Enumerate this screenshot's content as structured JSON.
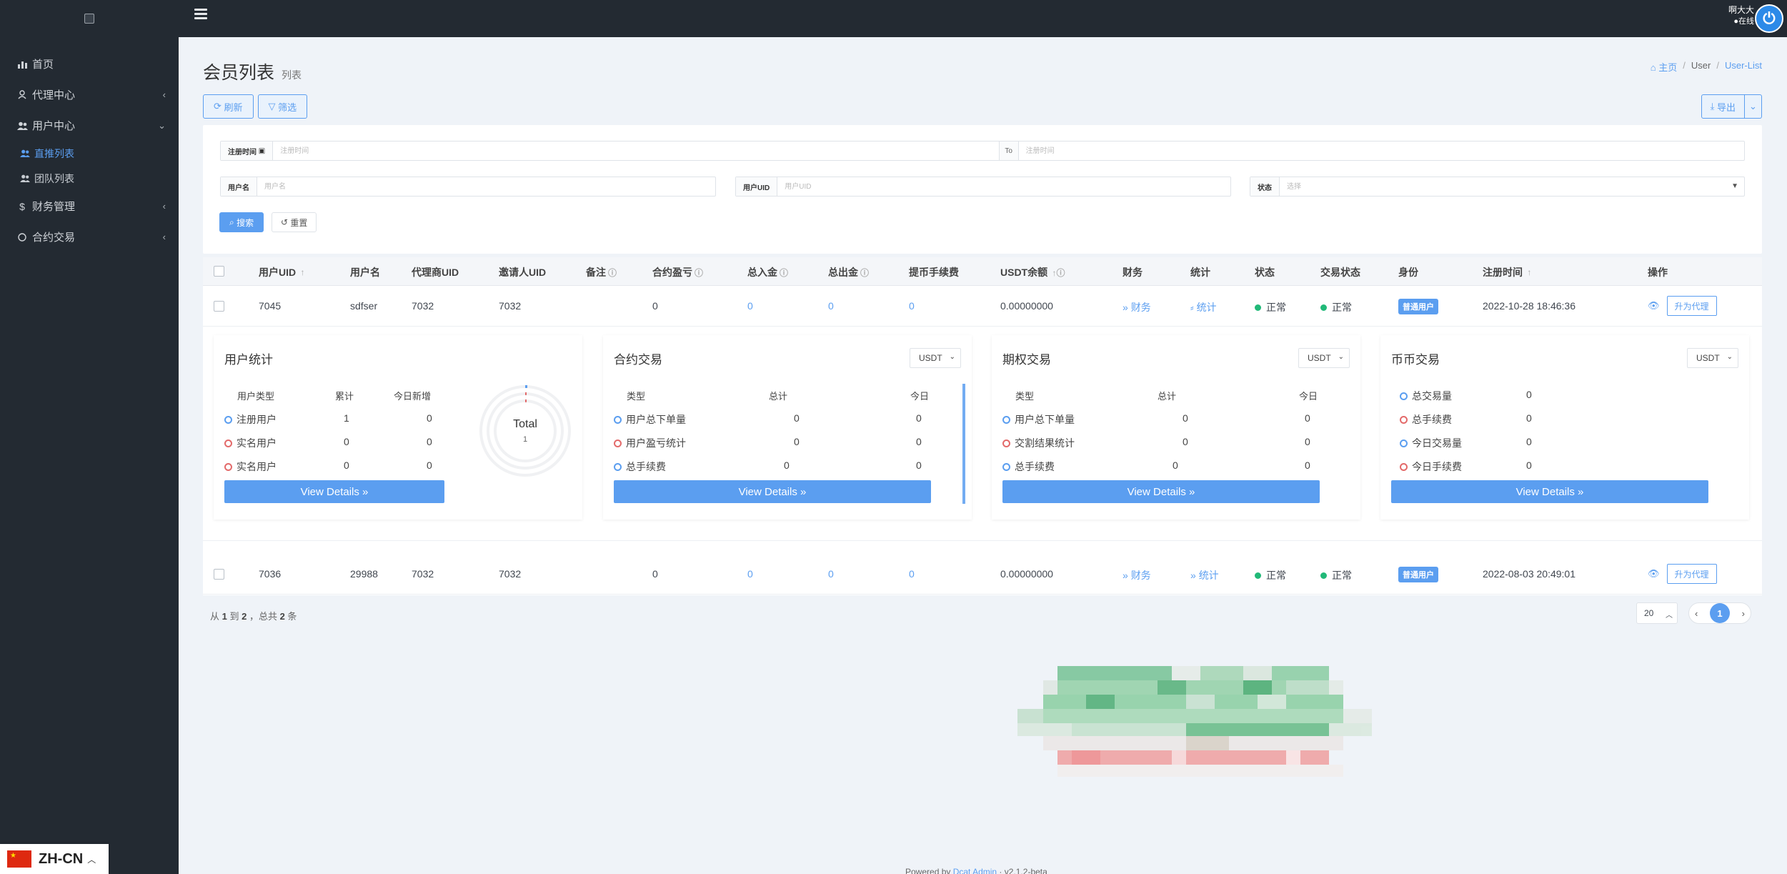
{
  "sidebar": {
    "items": [
      {
        "label": "首页",
        "icon": "bar-chart-icon"
      },
      {
        "label": "代理中心",
        "icon": "user-icon"
      },
      {
        "label": "用户中心",
        "icon": "users-icon"
      },
      {
        "label": "财务管理",
        "icon": "dollar-icon"
      },
      {
        "label": "合约交易",
        "icon": "circle-icon"
      }
    ],
    "sub_items": [
      {
        "label": "直推列表",
        "active": true
      },
      {
        "label": "团队列表",
        "active": false
      }
    ],
    "language": "ZH-CN"
  },
  "header": {
    "username": "啊大大",
    "status": "●在线"
  },
  "page": {
    "title": "会员列表",
    "subtitle": "列表",
    "breadcrumb": [
      "主页",
      "User",
      "User-List"
    ],
    "refresh_label": "刷新",
    "filter_label": "筛选",
    "export_label": "导出"
  },
  "filters": {
    "reg_time_label": "注册时间",
    "reg_time_placeholder": "注册时间",
    "to_label": "To",
    "reg_time_to_placeholder": "注册时间",
    "username_label": "用户名",
    "username_placeholder": "用户名",
    "uid_label": "用户UID",
    "uid_placeholder": "用户UID",
    "status_label": "状态",
    "status_placeholder": "选择",
    "search_label": "搜索",
    "reset_label": "重置"
  },
  "table": {
    "headers": {
      "uid": "用户UID",
      "username": "用户名",
      "agent_uid": "代理商UID",
      "inviter_uid": "邀请人UID",
      "remark": "备注",
      "contract_pnl": "合约盈亏",
      "total_in": "总入金",
      "total_out": "总出金",
      "withdraw_fee": "提币手续费",
      "usdt_balance": "USDT余额",
      "finance": "财务",
      "stats": "统计",
      "status": "状态",
      "trade_status": "交易状态",
      "identity": "身份",
      "reg_time": "注册时间",
      "action": "操作"
    },
    "rows": [
      {
        "uid": "7045",
        "username": "sdfser",
        "agent_uid": "7032",
        "inviter_uid": "7032",
        "remark": "",
        "contract_pnl": "0",
        "total_in": "0",
        "total_out": "0",
        "withdraw_fee": "0",
        "usdt_balance": "0.00000000",
        "finance": "财务",
        "stats": "统计",
        "status": "正常",
        "trade_status": "正常",
        "identity": "普通用户",
        "reg_time": "2022-10-28 18:46:36",
        "action": "升为代理"
      },
      {
        "uid": "7036",
        "username": "29988",
        "agent_uid": "7032",
        "inviter_uid": "7032",
        "remark": "",
        "contract_pnl": "0",
        "total_in": "0",
        "total_out": "0",
        "withdraw_fee": "0",
        "usdt_balance": "0.00000000",
        "finance": "财务",
        "stats": "统计",
        "status": "正常",
        "trade_status": "正常",
        "identity": "普通用户",
        "reg_time": "2022-08-03 20:49:01",
        "action": "升为代理"
      }
    ]
  },
  "detail": {
    "view_details": "View Details",
    "user_stats": {
      "title": "用户统计",
      "headers": [
        "用户类型",
        "累计",
        "今日新增"
      ],
      "rows": [
        {
          "name": "注册用户",
          "total": "1",
          "today": "0"
        },
        {
          "name": "实名用户",
          "total": "0",
          "today": "0"
        },
        {
          "name": "实名用户",
          "total": "0",
          "today": "0"
        }
      ],
      "donut_label": "Total",
      "donut_value": "1"
    },
    "contract": {
      "title": "合约交易",
      "currency": "USDT",
      "headers": [
        "类型",
        "总计",
        "今日"
      ],
      "rows": [
        {
          "name": "用户总下单量",
          "total": "0",
          "today": "0"
        },
        {
          "name": "用户盈亏统计",
          "total": "0",
          "today": "0"
        },
        {
          "name": "总手续费",
          "total": "0",
          "today": "0"
        }
      ]
    },
    "options": {
      "title": "期权交易",
      "currency": "USDT",
      "headers": [
        "类型",
        "总计",
        "今日"
      ],
      "rows": [
        {
          "name": "用户总下单量",
          "total": "0",
          "today": "0"
        },
        {
          "name": "交割结果统计",
          "total": "0",
          "today": "0"
        },
        {
          "name": "总手续费",
          "total": "0",
          "today": "0"
        }
      ]
    },
    "coin": {
      "title": "币币交易",
      "currency": "USDT",
      "rows": [
        {
          "name": "总交易量",
          "value": "0"
        },
        {
          "name": "总手续费",
          "value": "0"
        },
        {
          "name": "今日交易量",
          "value": "0"
        },
        {
          "name": "今日手续费",
          "value": "0"
        }
      ]
    }
  },
  "pagination": {
    "from": "1",
    "to": "2",
    "total": "2",
    "per_page": "20",
    "current": "1"
  },
  "footer": {
    "powered_by": "Powered by",
    "brand": "Dcat Admin",
    "version": "· v2.1.2-beta"
  },
  "colors": {
    "sidebar": "#232a32",
    "accent": "#5b9ef0",
    "success": "#21b978",
    "danger": "#e36a6a"
  }
}
